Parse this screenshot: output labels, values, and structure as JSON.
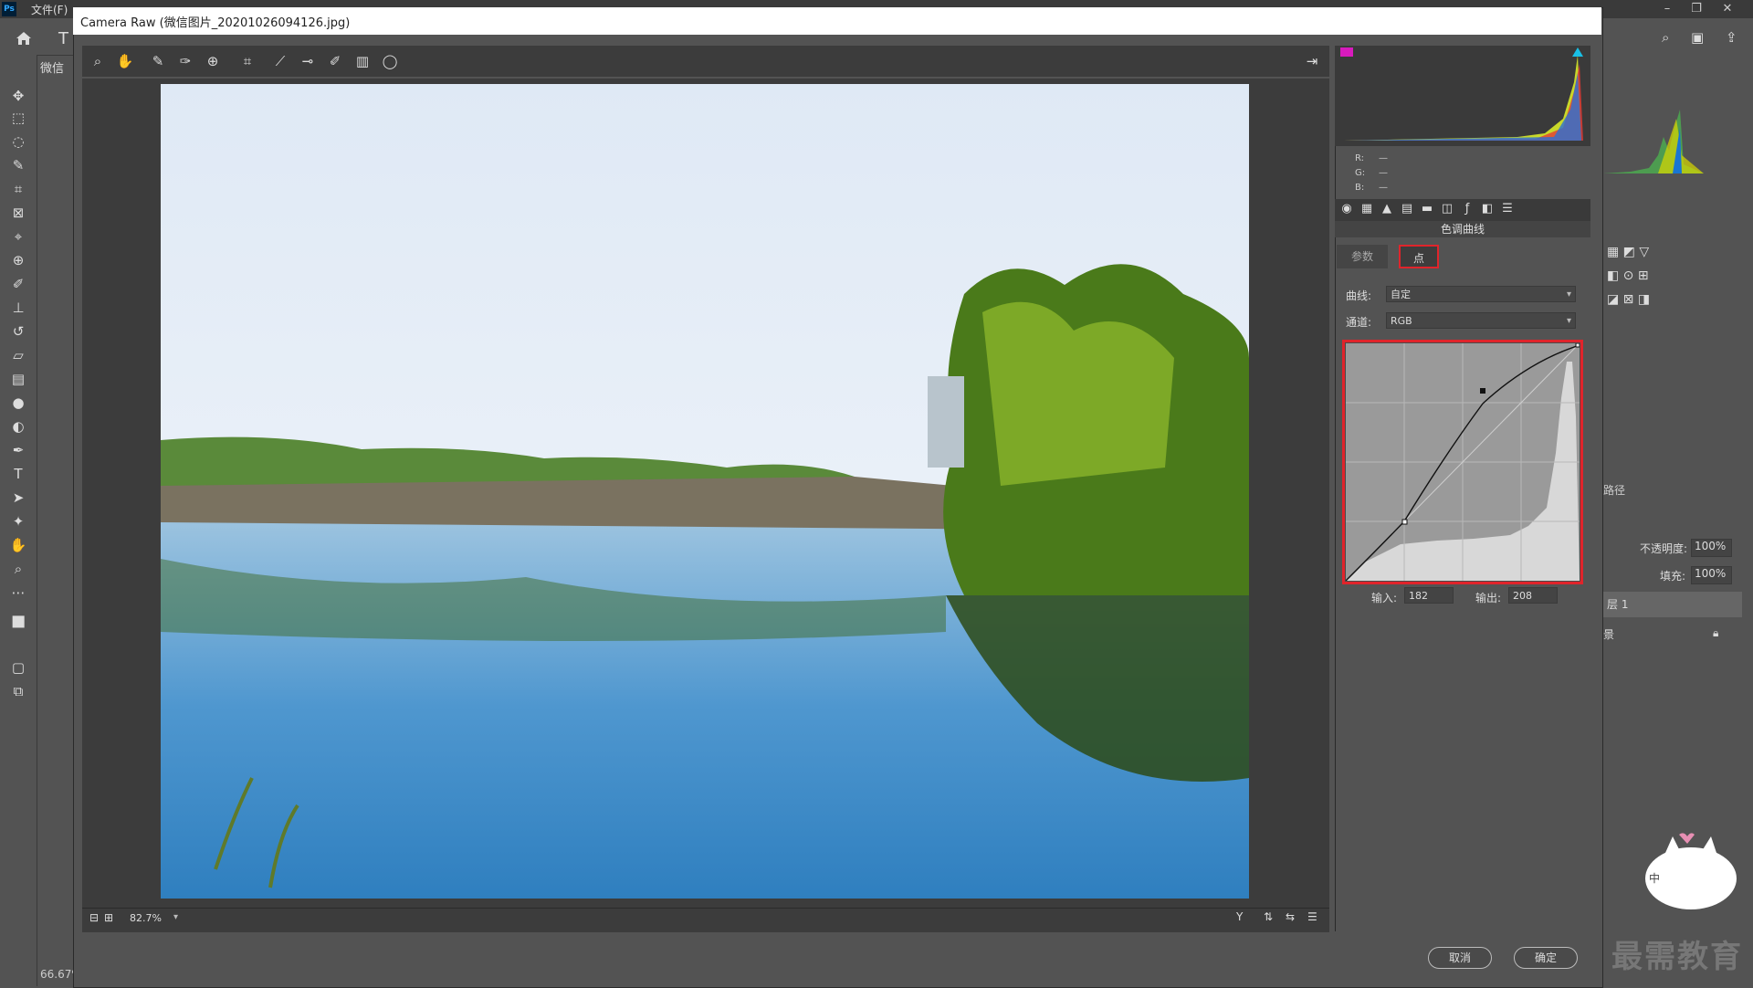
{
  "ps": {
    "logo": "Ps",
    "menu_file": "文件(F)",
    "doc_tab": "微信",
    "doc_zoom": "66.67%",
    "text_tool_glyph": "T",
    "panel_paths": "路径",
    "opacity_label": "不透明度:",
    "opacity_value": "100%",
    "fill_label": "填充:",
    "fill_value": "100%",
    "layer1": "层 1",
    "layer_bg": "景",
    "watermark": "最需教育"
  },
  "camera_raw": {
    "title": "Camera Raw (微信图片_20201026094126.jpg)",
    "zoom": "82.7%",
    "histogram_rgb": {
      "r_label": "R:",
      "g_label": "G:",
      "b_label": "B:",
      "r": "—",
      "g": "—",
      "b": "—"
    },
    "section_title": "色调曲线",
    "subtab_param": "参数",
    "subtab_point": "点",
    "curve_label": "曲线:",
    "curve_value": "自定",
    "channel_label": "通道:",
    "channel_value": "RGB",
    "input_label": "输入:",
    "input_value": "182",
    "output_label": "输出:",
    "output_value": "208",
    "cancel": "取消",
    "ok": "确定"
  },
  "colors": {
    "accent_red": "#e0242b",
    "panel": "#535353",
    "dark": "#3c3c3c"
  }
}
